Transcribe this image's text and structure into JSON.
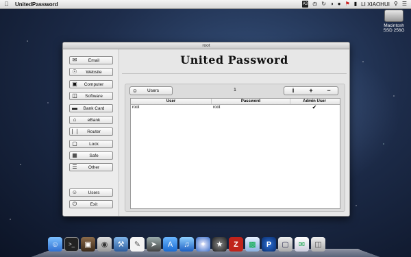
{
  "menubar": {
    "app_name": "UnitedPassword",
    "user_name": "LI XIAOHUI",
    "icons": [
      "apple-icon",
      "a3-icon",
      "shield-icon",
      "clock-icon",
      "sync-icon",
      "wifi-icon",
      "flag-icon",
      "battery-icon",
      "search-icon",
      "list-icon"
    ],
    "input_badge": "A3"
  },
  "desktop": {
    "drive_name": "Macintosh SSD 256G"
  },
  "window": {
    "title": "root",
    "app_title": "United Password",
    "sidebar": [
      {
        "label": "Email",
        "icon": "email-icon"
      },
      {
        "label": "Website",
        "icon": "globe-icon"
      },
      {
        "label": "Computer",
        "icon": "computer-icon"
      },
      {
        "label": "Software",
        "icon": "software-icon"
      },
      {
        "label": "Bank Card",
        "icon": "card-icon"
      },
      {
        "label": "eBank",
        "icon": "bank-icon"
      },
      {
        "label": "Router",
        "icon": "router-icon"
      },
      {
        "label": "Lock",
        "icon": "lock-icon"
      },
      {
        "label": "Safe",
        "icon": "safe-icon"
      },
      {
        "label": "Other",
        "icon": "menu-icon"
      }
    ],
    "sidebar_bottom": [
      {
        "label": "Users",
        "icon": "users-icon"
      },
      {
        "label": "Exit",
        "icon": "power-icon"
      }
    ],
    "users_button": "Users",
    "count": "1",
    "segment": [
      "i",
      "+",
      "−"
    ],
    "table": {
      "columns": [
        "User",
        "Password",
        "Admin User"
      ],
      "rows": [
        {
          "user": "root",
          "password": "root",
          "admin": "✔"
        }
      ]
    }
  },
  "dock": [
    "finder",
    "terminal",
    "photos",
    "preview",
    "xcode",
    "textedit",
    "launchpad",
    "app-store",
    "itunes",
    "safari",
    "chrome",
    "filezilla",
    "charts",
    "pockets",
    "mail-window",
    "mail",
    "trash"
  ]
}
